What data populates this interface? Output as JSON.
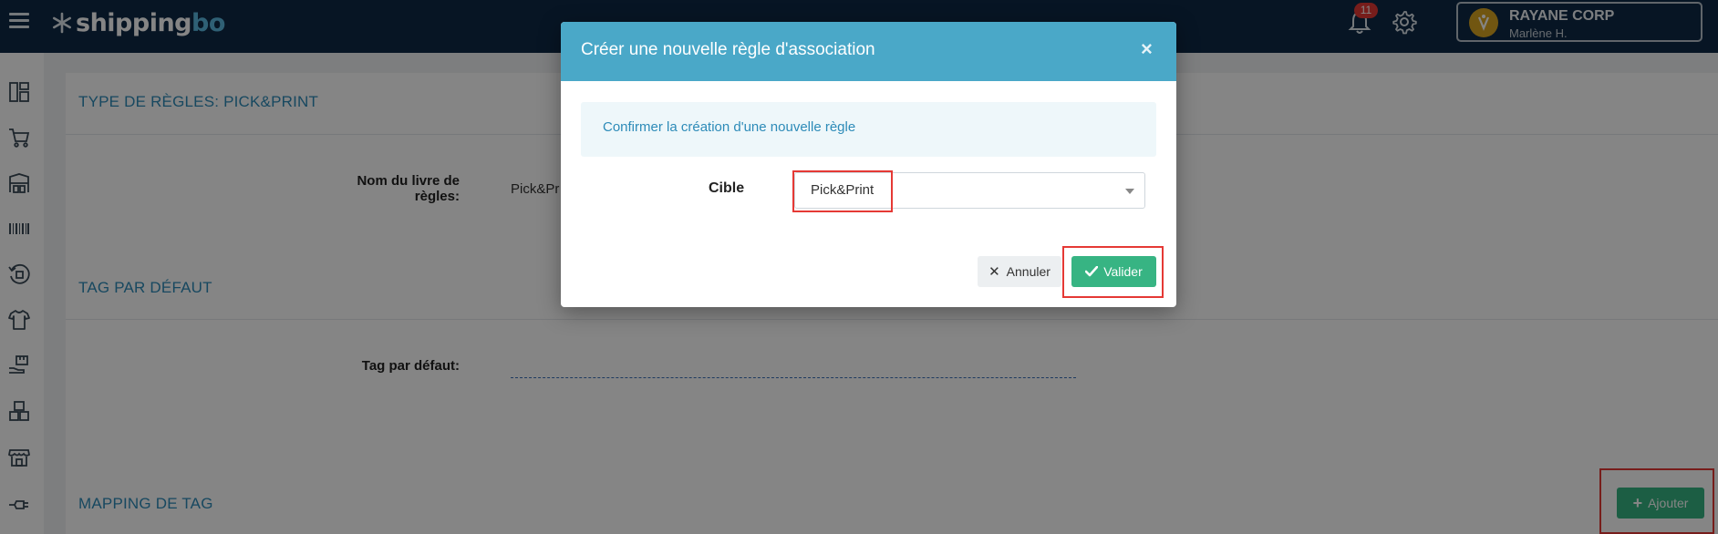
{
  "app": {
    "brand": "shipping",
    "brand_suffix": "bo",
    "notifications_count": "11",
    "company": "RAYANE CORP",
    "user": "Marlène H."
  },
  "sidebar": {
    "icons": [
      "dashboard-icon",
      "cart-icon",
      "warehouse-icon",
      "barcode-icon",
      "returns-icon",
      "tshirt-icon",
      "hand-box-icon",
      "boxes-icon",
      "store-icon",
      "plug-icon"
    ]
  },
  "main": {
    "section1_title": "TYPE DE RÈGLES: PICK&PRINT",
    "rulebook_label": "Nom du livre de règles:",
    "rulebook_value": "Pick&Pr",
    "section2_title": "TAG PAR DÉFAUT",
    "default_tag_label": "Tag par défaut:",
    "section3_title": "MAPPING DE TAG",
    "add_label": "Ajouter"
  },
  "modal": {
    "title": "Créer une nouvelle règle d'association",
    "close": "×",
    "info": "Confirmer la création d'une nouvelle règle",
    "target_label": "Cible",
    "target_value": "Pick&Print",
    "cancel_label": "Annuler",
    "validate_label": "Valider"
  },
  "colors": {
    "topbar": "#0f2a45",
    "modal_header": "#4aa8c8",
    "accent_green": "#37b483",
    "section_title": "#2d8bb8",
    "highlight": "#e53935"
  }
}
